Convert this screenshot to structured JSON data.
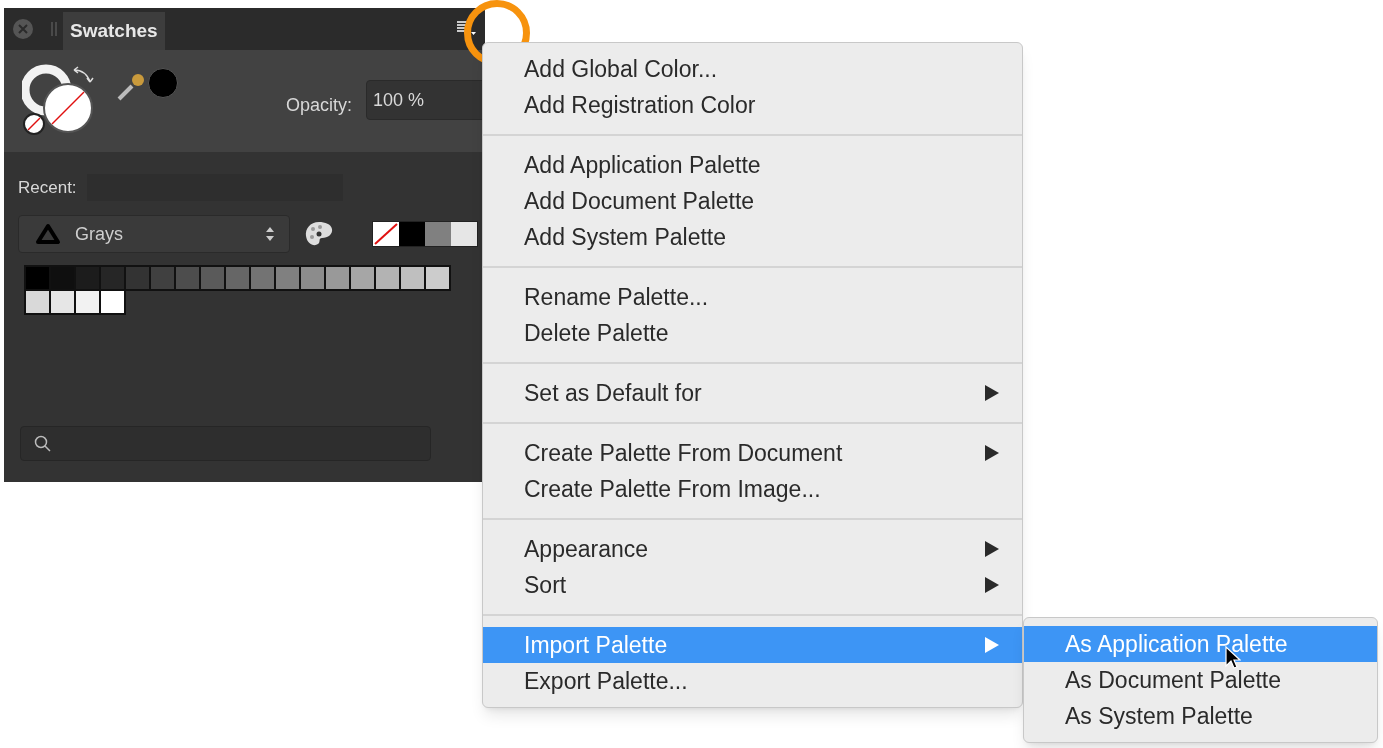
{
  "panel": {
    "tab": "Swatches",
    "opacity_label": "Opacity:",
    "opacity_value": "100 %",
    "recent_label": "Recent:",
    "palette": "Grays",
    "quick_swatches": [
      {
        "kind": "none"
      },
      {
        "kind": "color",
        "color": "#000000"
      },
      {
        "kind": "color",
        "color": "#808080"
      },
      {
        "kind": "color",
        "color": "#e6e6e6"
      }
    ],
    "swatches": [
      {
        "color": "#000000"
      },
      {
        "color": "#0f0f0f"
      },
      {
        "color": "#1c1c1c"
      },
      {
        "color": "#262626"
      },
      {
        "color": "#333333"
      },
      {
        "color": "#404040"
      },
      {
        "color": "#4d4d4d"
      },
      {
        "color": "#5a5a5a"
      },
      {
        "color": "#666666"
      },
      {
        "color": "#737373"
      },
      {
        "color": "#808080"
      },
      {
        "color": "#8c8c8c"
      },
      {
        "color": "#999999"
      },
      {
        "color": "#a6a6a6"
      },
      {
        "color": "#b3b3b3"
      },
      {
        "color": "#bfbfbf"
      },
      {
        "color": "#cccccc"
      },
      {
        "color": "#d9d9d9"
      },
      {
        "color": "#e6e6e6"
      },
      {
        "color": "#f2f2f2"
      },
      {
        "color": "#ffffff"
      }
    ]
  },
  "menu": {
    "groups": [
      [
        {
          "label": "Add Global Color...",
          "submenu": false,
          "selected": false
        },
        {
          "label": "Add Registration Color",
          "submenu": false,
          "selected": false
        }
      ],
      [
        {
          "label": "Add Application Palette",
          "submenu": false,
          "selected": false
        },
        {
          "label": "Add Document Palette",
          "submenu": false,
          "selected": false
        },
        {
          "label": "Add System Palette",
          "submenu": false,
          "selected": false
        }
      ],
      [
        {
          "label": "Rename Palette...",
          "submenu": false,
          "selected": false
        },
        {
          "label": "Delete Palette",
          "submenu": false,
          "selected": false
        }
      ],
      [
        {
          "label": "Set as Default for",
          "submenu": true,
          "selected": false
        }
      ],
      [
        {
          "label": "Create Palette From Document",
          "submenu": true,
          "selected": false
        },
        {
          "label": "Create Palette From Image...",
          "submenu": false,
          "selected": false
        }
      ],
      [
        {
          "label": "Appearance",
          "submenu": true,
          "selected": false
        },
        {
          "label": "Sort",
          "submenu": true,
          "selected": false
        }
      ],
      [
        {
          "label": "Import Palette",
          "submenu": true,
          "selected": true
        },
        {
          "label": "Export Palette...",
          "submenu": false,
          "selected": false
        }
      ]
    ]
  },
  "submenu": [
    {
      "label": "As Application Palette",
      "selected": true
    },
    {
      "label": "As Document Palette",
      "selected": false
    },
    {
      "label": "As System Palette",
      "selected": false
    }
  ]
}
